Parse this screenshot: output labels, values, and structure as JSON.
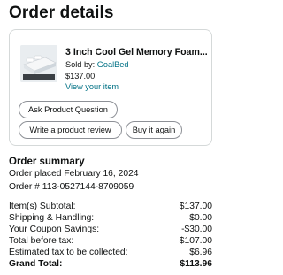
{
  "page": {
    "title": "Order details"
  },
  "item": {
    "title": "3 Inch Cool Gel Memory Foam...",
    "sold_by_label": "Sold by:",
    "seller": "GoalBed",
    "price": "$137.00",
    "view_link": "View your item"
  },
  "actions": {
    "ask_question": "Ask Product Question",
    "write_review": "Write a product review",
    "buy_again": "Buy it again"
  },
  "summary": {
    "title": "Order summary",
    "placed": "Order placed February 16, 2024",
    "order_number": "Order # 113-0527144-8709059",
    "rows": [
      {
        "label": "Item(s) Subtotal:",
        "value": "$137.00"
      },
      {
        "label": "Shipping & Handling:",
        "value": "$0.00"
      },
      {
        "label": "Your Coupon Savings:",
        "value": "-$30.00"
      },
      {
        "label": "Total before tax:",
        "value": "$107.00"
      },
      {
        "label": "Estimated tax to be collected:",
        "value": "$6.96"
      },
      {
        "label": "Grand Total:",
        "value": "$113.96"
      }
    ]
  }
}
